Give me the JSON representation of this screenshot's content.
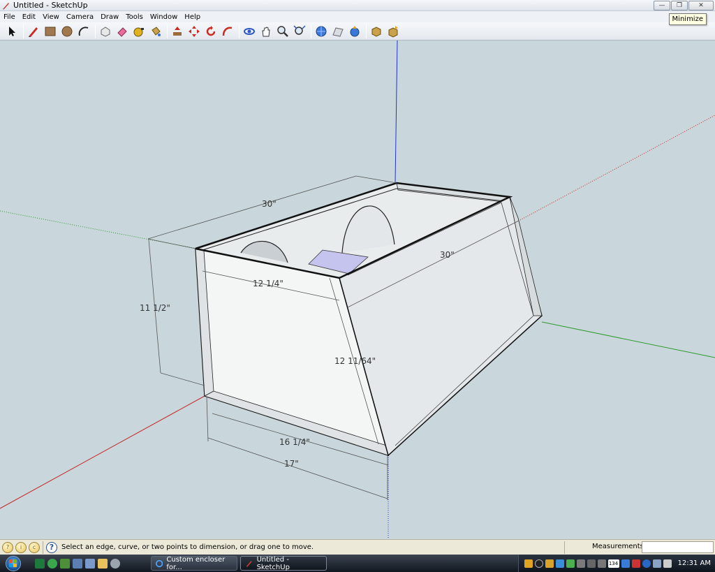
{
  "window": {
    "title": "Untitled - SketchUp",
    "tooltip": "Minimize"
  },
  "menu": [
    "File",
    "Edit",
    "View",
    "Camera",
    "Draw",
    "Tools",
    "Window",
    "Help"
  ],
  "toolbar": {
    "tools": [
      "select",
      "pencil",
      "rectangle",
      "circle",
      "arc",
      "make-component",
      "eraser",
      "tape-measure",
      "paint-bucket",
      "push-pull",
      "move",
      "rotate",
      "follow-me",
      "orbit",
      "pan",
      "zoom",
      "zoom-extents",
      "previous",
      "get-models",
      "share-model",
      "get-photo-texture",
      "section"
    ]
  },
  "model": {
    "dimensions": {
      "top_length": "30\"",
      "side_length": "30\"",
      "height": "11 1/2\"",
      "inner_width": "12 1/4\"",
      "slant": "12 11/64\"",
      "bottom_inner": "16 1/4\"",
      "bottom_outer": "17\""
    },
    "axis_colors": {
      "red": "#c62828",
      "green": "#2e9a2e",
      "blue": "#2233cc"
    }
  },
  "status": {
    "text": "Select an edge, curve, or two points to dimension, or drag one to move.",
    "measurements_label": "Measurements",
    "measurements_value": ""
  },
  "taskbar": {
    "tasks": [
      {
        "label": "Custom encloser for...",
        "active": false
      },
      {
        "label": "Untitled - SketchUp",
        "active": true
      }
    ],
    "tray_badge": "134",
    "clock": "12:31 AM"
  }
}
